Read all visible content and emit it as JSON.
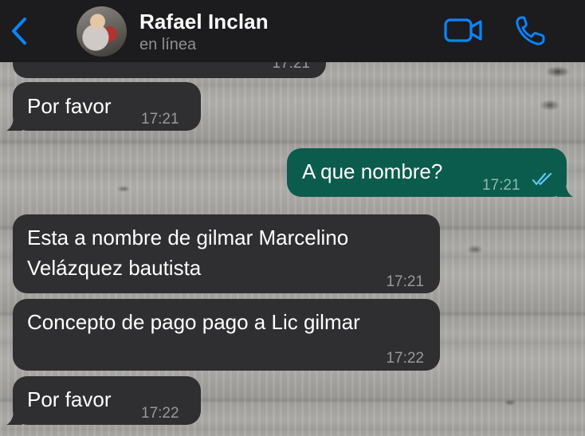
{
  "header": {
    "contact_name": "Rafael Inclan",
    "status": "en línea",
    "back_icon": "chevron-left-icon",
    "video_icon": "video-camera-icon",
    "call_icon": "phone-icon",
    "accent": "#0a84ff"
  },
  "messages": [
    {
      "direction": "in",
      "text": "",
      "time": "17:21"
    },
    {
      "direction": "in",
      "text": "Por favor",
      "time": "17:21"
    },
    {
      "direction": "out",
      "text": "A que nombre?",
      "time": "17:21",
      "status": "read"
    },
    {
      "direction": "in",
      "text_line1": "Esta a nombre de gilmar Marcelino",
      "text_line2": "Velázquez bautista",
      "time": "17:21"
    },
    {
      "direction": "in",
      "text": "Concepto de pago pago a Lic gilmar",
      "time": "17:22"
    },
    {
      "direction": "in",
      "text": "Por favor",
      "time": "17:22"
    }
  ],
  "colors": {
    "incoming_bubble": "#2f2f31",
    "outgoing_bubble": "#0c5c4d",
    "read_ticks": "#5ac8fa"
  }
}
